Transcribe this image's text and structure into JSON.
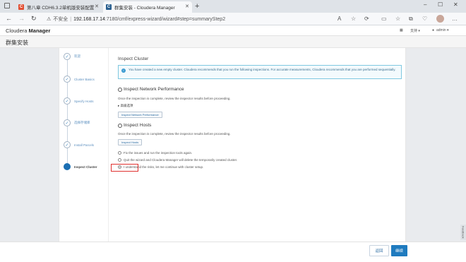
{
  "browser": {
    "tabs": [
      {
        "label": "第八章 CDH6.3.2单机版安装配置",
        "favicon": "C",
        "favicon_color": "#e24f33"
      },
      {
        "label": "群集安装 - Cloudera Manager",
        "favicon": "C",
        "favicon_color": "#2a5f8f"
      }
    ],
    "new_tab": "+",
    "address": {
      "security_label": "不安全",
      "host": "192.168.17.14",
      "path": ":7180/cmf/express-wizard/wizard#step=summaryStep2"
    }
  },
  "app": {
    "brand_prefix": "Cloudera",
    "brand_bold": "Manager",
    "support_label": "支持 ▾",
    "user_label": "admin ▾",
    "page_title": "群集安装"
  },
  "steps": [
    {
      "label": "欢迎",
      "state": "done"
    },
    {
      "label": "Cluster Basics",
      "state": "done"
    },
    {
      "label": "Specify Hosts",
      "state": "done"
    },
    {
      "label": "选择存储库",
      "state": "done"
    },
    {
      "label": "Install Parcels",
      "state": "done"
    },
    {
      "label": "Inspect Cluster",
      "state": "active"
    }
  ],
  "content": {
    "heading": "Inspect Cluster",
    "info": "You have created a new empty cluster. Cloudera recommends that you run the following inspections. For accurate measurements, Cloudera recommends that you are performed sequentially.",
    "network": {
      "title": "Inspect Network Performance",
      "desc": "Once the inspection is complete, review the inspector results before proceeding.",
      "expander": "高级选项",
      "button": "Inspect Network Performance"
    },
    "hosts": {
      "title": "Inspect Hosts",
      "desc": "Once the inspection is complete, review the inspector results before proceeding.",
      "button": "Inspect Hosts"
    },
    "options": [
      {
        "label": "Fix the issues and run the inspection tools again.",
        "selected": false
      },
      {
        "label": "Quit the wizard and Cloudera Manager will delete the temporarily created cluster.",
        "selected": false
      },
      {
        "label": "I understand the risks, let me continue with cluster setup.",
        "selected": true
      }
    ]
  },
  "footer": {
    "back_label": "返回",
    "continue_label": "继续"
  },
  "feedback_label": "Feedback",
  "colors": {
    "primary": "#1f7bbf",
    "highlight": "#e0312f"
  }
}
